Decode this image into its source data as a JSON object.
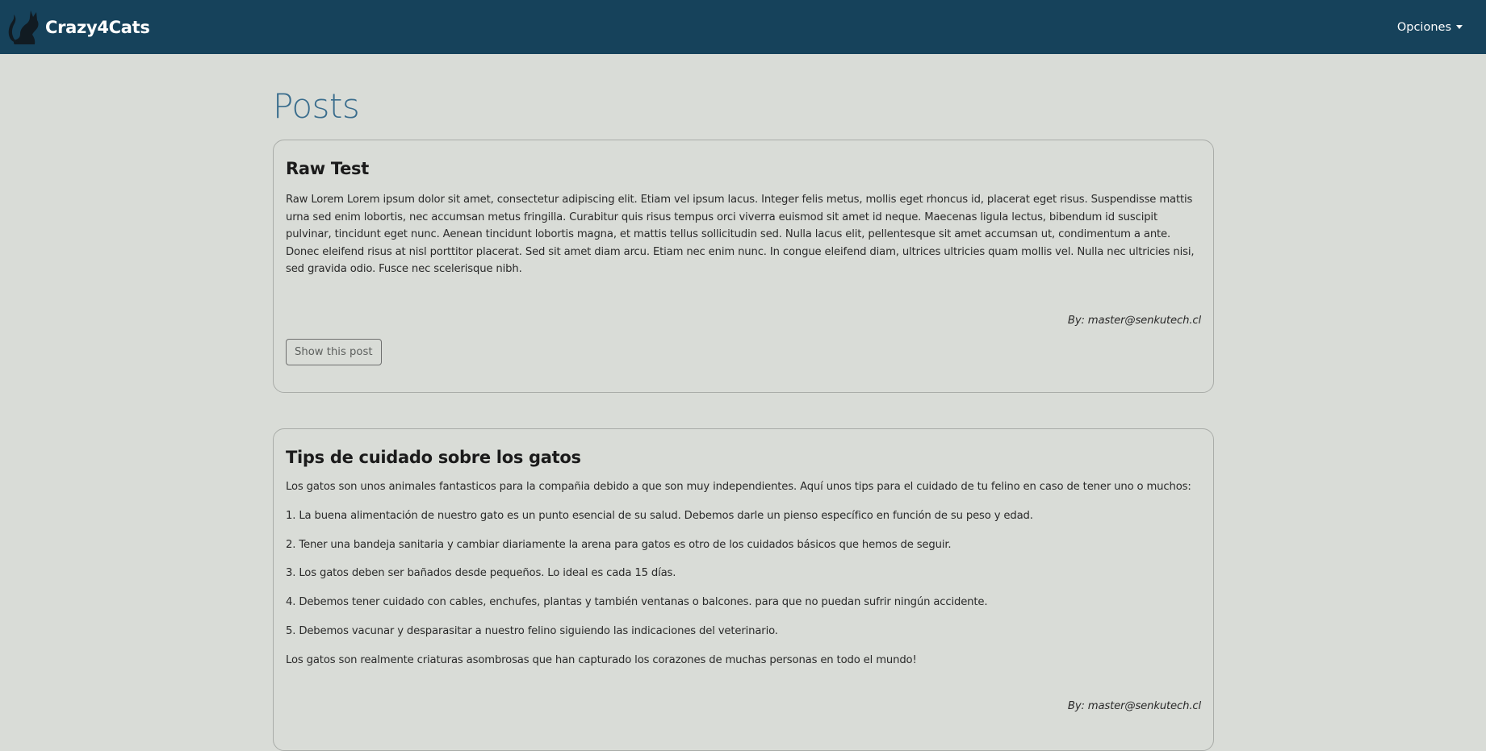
{
  "navbar": {
    "brand": "Crazy4Cats",
    "logo_icon": "cat-silhouette-icon",
    "options_label": "Opciones",
    "background": "#16425b"
  },
  "page": {
    "title": "Posts"
  },
  "posts": [
    {
      "title": "Raw Test",
      "body": "Raw Lorem Lorem ipsum dolor sit amet, consectetur adipiscing elit. Etiam vel ipsum lacus. Integer felis metus, mollis eget rhoncus id, placerat eget risus. Suspendisse mattis urna sed enim lobortis, nec accumsan metus fringilla. Curabitur quis risus tempus orci viverra euismod sit amet id neque. Maecenas ligula lectus, bibendum id suscipit pulvinar, tincidunt eget nunc. Aenean tincidunt lobortis magna, et mattis tellus sollicitudin sed. Nulla lacus elit, pellentesque sit amet accumsan ut, condimentum a ante. Donec eleifend risus at nisl porttitor placerat. Sed sit amet diam arcu. Etiam nec enim nunc. In congue eleifend diam, ultrices ultricies quam mollis vel. Nulla nec ultricies nisi, sed gravida odio. Fusce nec scelerisque nibh.",
      "author": "By: master@senkutech.cl",
      "button_label": "Show this post"
    },
    {
      "title": "Tips de cuidado sobre los gatos",
      "paragraphs": [
        "Los gatos son unos animales fantasticos para la compañia debido a que son muy independientes. Aquí unos tips para el cuidado de tu felino en caso de tener uno o muchos:",
        "1. La buena alimentación de nuestro gato es un punto esencial de su salud. Debemos darle un pienso específico en función de su peso y edad.",
        "2. Tener una bandeja sanitaria y cambiar diariamente la arena para gatos es otro de los cuidados básicos que hemos de seguir.",
        "3. Los gatos deben ser bañados desde pequeños. Lo ideal es cada 15 días.",
        "4. Debemos tener cuidado con cables, enchufes, plantas y también ventanas o balcones. para que no puedan sufrir ningún accidente.",
        "5. Debemos vacunar y desparasitar a nuestro felino siguiendo las indicaciones del veterinario.",
        "Los gatos son realmente criaturas asombrosas que han capturado los corazones de muchas personas en todo el mundo!"
      ],
      "author": "By: master@senkutech.cl"
    }
  ]
}
